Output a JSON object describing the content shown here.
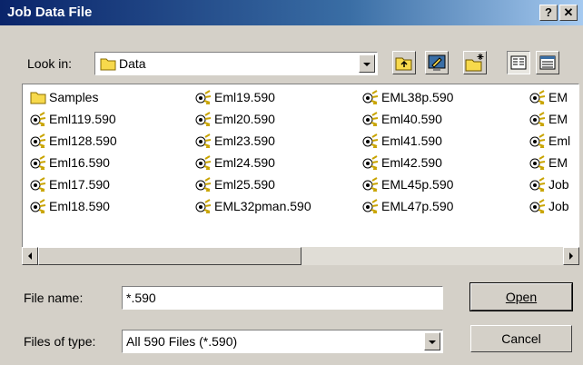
{
  "window": {
    "title": "Job Data File",
    "help_label": "?",
    "close_label": "✕"
  },
  "look_in": {
    "label": "Look in:",
    "value": "Data"
  },
  "files": [
    {
      "name": "Samples",
      "type": "folder"
    },
    {
      "name": "Eml119.590",
      "type": "file"
    },
    {
      "name": "Eml128.590",
      "type": "file"
    },
    {
      "name": "Eml16.590",
      "type": "file"
    },
    {
      "name": "Eml17.590",
      "type": "file"
    },
    {
      "name": "Eml18.590",
      "type": "file"
    },
    {
      "name": "Eml19.590",
      "type": "file"
    },
    {
      "name": "Eml20.590",
      "type": "file"
    },
    {
      "name": "Eml23.590",
      "type": "file"
    },
    {
      "name": "Eml24.590",
      "type": "file"
    },
    {
      "name": "Eml25.590",
      "type": "file"
    },
    {
      "name": "EML32pman.590",
      "type": "file"
    },
    {
      "name": "EML38p.590",
      "type": "file"
    },
    {
      "name": "Eml40.590",
      "type": "file"
    },
    {
      "name": "Eml41.590",
      "type": "file"
    },
    {
      "name": "Eml42.590",
      "type": "file"
    },
    {
      "name": "EML45p.590",
      "type": "file"
    },
    {
      "name": "EML47p.590",
      "type": "file"
    },
    {
      "name": "EM",
      "type": "file"
    },
    {
      "name": "EM",
      "type": "file"
    },
    {
      "name": "Eml",
      "type": "file"
    },
    {
      "name": "EM",
      "type": "file"
    },
    {
      "name": "Job",
      "type": "file"
    },
    {
      "name": "Job",
      "type": "file"
    }
  ],
  "file_name": {
    "label": "File name:",
    "value": "*.590"
  },
  "file_type": {
    "label": "Files of type:",
    "value": "All 590 Files (*.590)"
  },
  "buttons": {
    "open": "Open",
    "cancel": "Cancel"
  },
  "icons": [
    "folder-icon",
    "up-folder-icon",
    "desktop-icon",
    "new-folder-icon",
    "list-view-icon",
    "details-view-icon",
    "file-icon"
  ],
  "colors": {
    "titlebar_start": "#0a246a",
    "titlebar_end": "#a6caf0",
    "face": "#d4d0c8"
  }
}
